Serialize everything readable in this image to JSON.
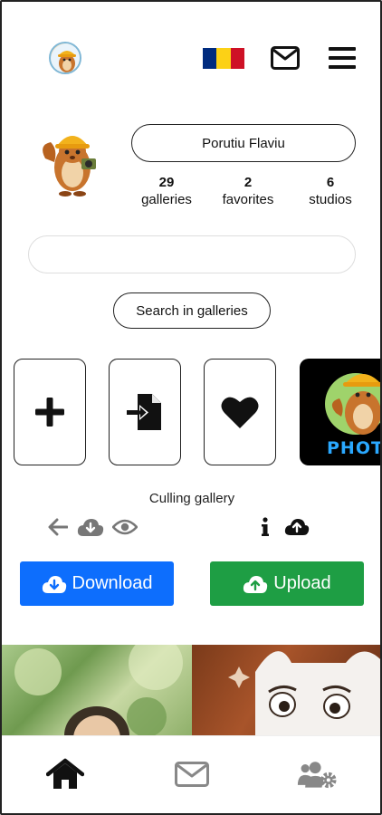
{
  "header": {
    "avatar_icon": "mascot-avatar-icon",
    "flag_colors": [
      "#002b7f",
      "#fcd116",
      "#ce1126"
    ],
    "mail_icon": "envelope-icon",
    "menu_icon": "hamburger-icon"
  },
  "profile": {
    "name": "Porutiu Flaviu",
    "stats": [
      {
        "count": "29",
        "label": "galleries"
      },
      {
        "count": "2",
        "label": "favorites"
      },
      {
        "count": "6",
        "label": "studios"
      }
    ]
  },
  "search": {
    "placeholder": "",
    "button_label": "Search in galleries"
  },
  "tiles": [
    {
      "icon": "plus-icon"
    },
    {
      "icon": "file-import-icon"
    },
    {
      "icon": "heart-icon"
    },
    {
      "icon": "photo-thumbnail",
      "text": "PHOTO"
    }
  ],
  "gallery": {
    "title": "Culling gallery",
    "icons_left": [
      "arrow-left-icon",
      "cloud-download-icon",
      "eye-icon"
    ],
    "icons_right": [
      "info-icon",
      "cloud-upload-icon"
    ]
  },
  "actions": {
    "download_label": "Download",
    "upload_label": "Upload",
    "download_color": "#0d6efd",
    "upload_color": "#1e9e44"
  },
  "bottom_nav": [
    {
      "icon": "home-icon",
      "active": true
    },
    {
      "icon": "envelope-icon",
      "active": false
    },
    {
      "icon": "users-cog-icon",
      "active": false
    }
  ]
}
